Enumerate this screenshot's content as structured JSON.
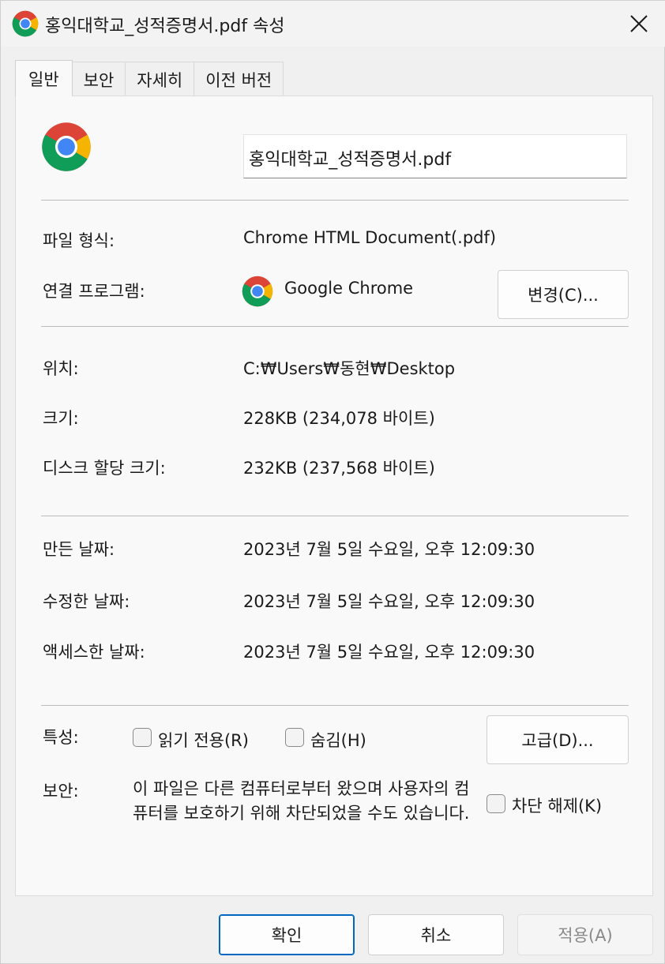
{
  "window": {
    "title": "홍익대학교_성적증명서.pdf 속성",
    "icon": "chrome-icon",
    "close_icon": "close-icon"
  },
  "tabs": [
    {
      "label": "일반",
      "active": true
    },
    {
      "label": "보안",
      "active": false
    },
    {
      "label": "자세히",
      "active": false
    },
    {
      "label": "이전 버전",
      "active": false
    }
  ],
  "general": {
    "filename": "홍익대학교_성적증명서.pdf",
    "file_type_label": "파일 형식:",
    "file_type_value": "Chrome HTML Document(.pdf)",
    "opens_with_label": "연결 프로그램:",
    "opens_with_value": "Google Chrome",
    "change_button": "변경(C)...",
    "location_label": "위치:",
    "location_value": "C:₩Users₩동현₩Desktop",
    "size_label": "크기:",
    "size_value": "228KB (234,078 바이트)",
    "size_on_disk_label": "디스크 할당 크기:",
    "size_on_disk_value": "232KB (237,568 바이트)",
    "created_label": "만든 날짜:",
    "created_value": "2023년 7월 5일 수요일, 오후 12:09:30",
    "modified_label": "수정한 날짜:",
    "modified_value": "2023년 7월 5일 수요일, 오후 12:09:30",
    "accessed_label": "액세스한 날짜:",
    "accessed_value": "2023년 7월 5일 수요일, 오후 12:09:30",
    "attributes_label": "특성:",
    "readonly_label": "읽기 전용(R)",
    "readonly_checked": false,
    "hidden_label": "숨김(H)",
    "hidden_checked": false,
    "advanced_button": "고급(D)...",
    "security_label": "보안:",
    "security_text": "이 파일은 다른 컴퓨터로부터 왔으며 사용자의 컴퓨터를 보호하기 위해 차단되었을 수도 있습니다.",
    "unblock_label": "차단 해제(K)",
    "unblock_checked": false
  },
  "footer": {
    "ok": "확인",
    "cancel": "취소",
    "apply": "적용(A)"
  },
  "colors": {
    "accent": "#0067c0",
    "chrome_red": "#db4437",
    "chrome_green": "#0f9d58",
    "chrome_yellow": "#f4b400",
    "chrome_blue": "#4285f4"
  }
}
